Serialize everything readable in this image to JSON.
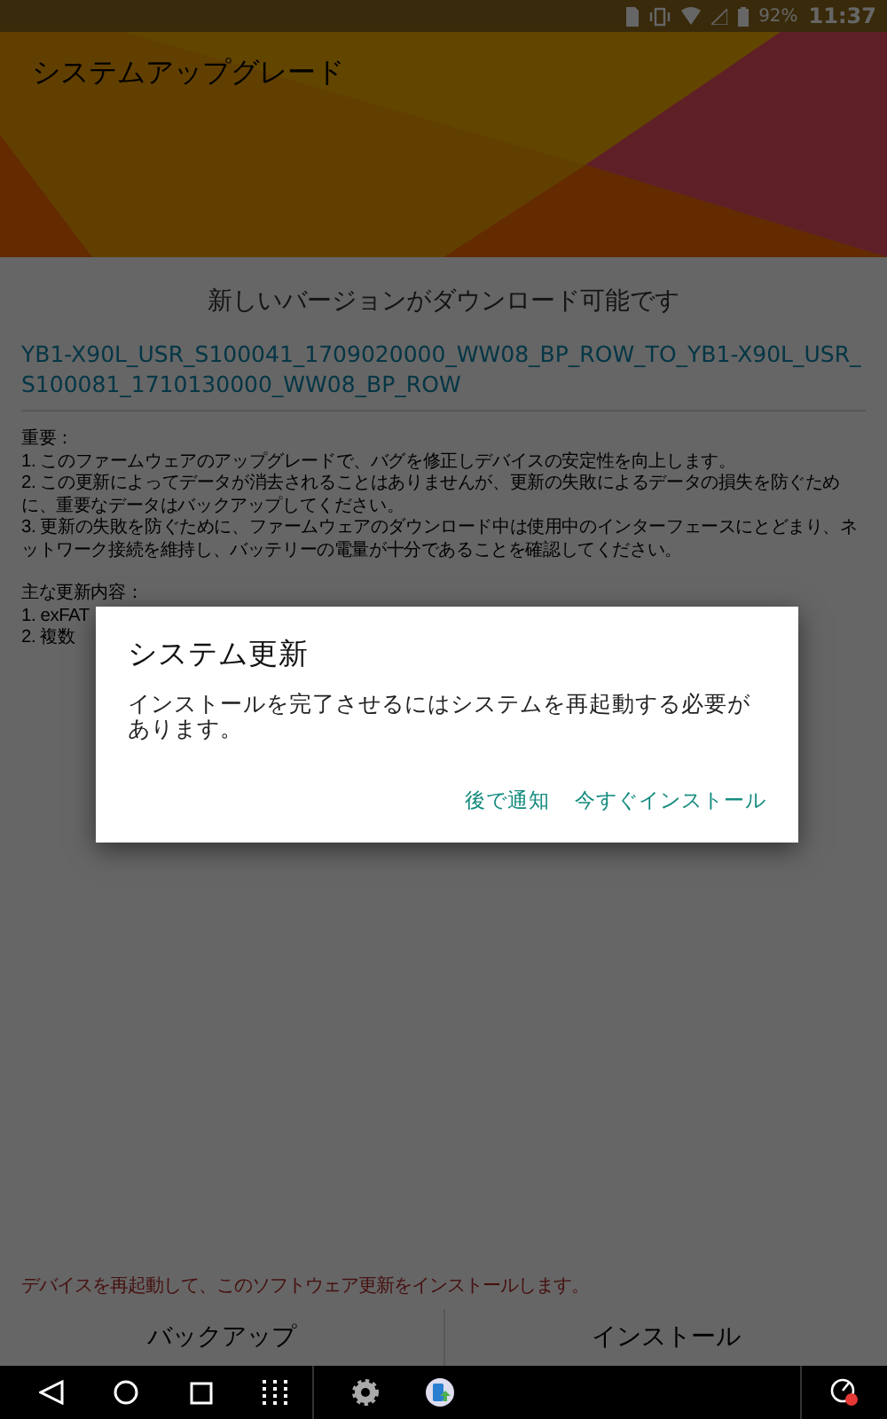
{
  "status_bar": {
    "battery": "92%",
    "time": "11:37"
  },
  "header": {
    "title": "システムアップグレード"
  },
  "content": {
    "headline": "新しいバージョンがダウンロード可能です",
    "package_name": "YB1-X90L_USR_S100041_1709020000_WW08_BP_ROW_TO_YB1-X90L_USR_S100081_1710130000_WW08_BP_ROW",
    "notes": [
      "重要：",
      "1. このファームウェアのアップグレードで、バグを修正しデバイスの安定性を向上します。",
      "2. この更新によってデータが消去されることはありませんが、更新の失敗によるデータの損失を防ぐために、重要なデータはバックアップしてください。",
      "3. 更新の失敗を防ぐために、ファームウェアのダウンロード中は使用中のインターフェースにとどまり、ネットワーク接続を維持し、バッテリーの電量が十分であることを確認してください。"
    ],
    "changes_title": "主な更新内容：",
    "changes": [
      "1. exFAT",
      "2. 複数"
    ]
  },
  "warning": "デバイスを再起動して、このソフトウェア更新をインストールします。",
  "actions": [
    "バックアップ",
    "インストール"
  ],
  "dialog": {
    "title": "システム更新",
    "message": "インストールを完了させるにはシステムを再起動する必要があります。",
    "buttons": [
      "後で通知",
      "今すぐインストール"
    ]
  }
}
